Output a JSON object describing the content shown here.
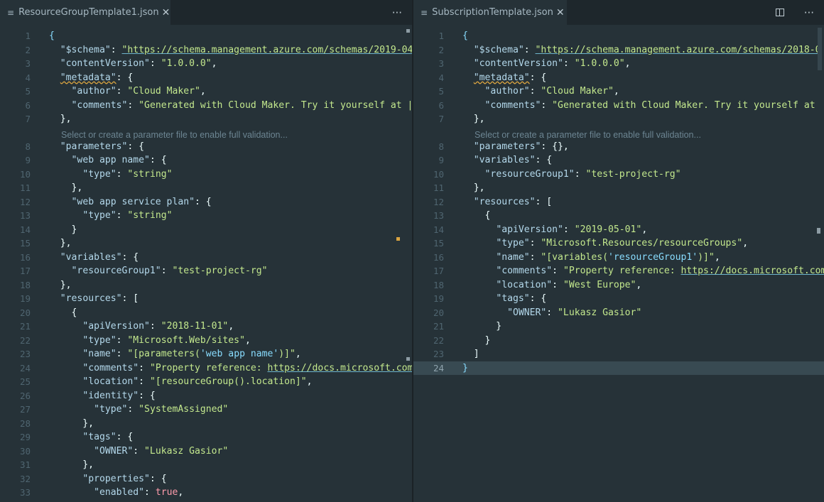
{
  "left": {
    "tab": {
      "icon": "≡",
      "title": "ResourceGroupTemplate1.json",
      "close": "✕"
    },
    "more": "···",
    "hint": "Select or create a parameter file to enable full validation...",
    "lines": [
      {
        "n": "1",
        "html": "<span class=\"p\">{</span>"
      },
      {
        "n": "2",
        "html": "  <span class=\"key\">\"$schema\"</span>: <span class=\"str url\">\"https://schema.management.azure.com/schemas/2019-04</span>"
      },
      {
        "n": "3",
        "html": "  <span class=\"key\">\"contentVersion\"</span>: <span class=\"str\">\"1.0.0.0\"</span>,"
      },
      {
        "n": "4",
        "html": "  <span class=\"key squig\">\"metadata\"</span>: {"
      },
      {
        "n": "5",
        "html": "    <span class=\"key\">\"author\"</span>: <span class=\"str\">\"Cloud Maker\"</span>,"
      },
      {
        "n": "6",
        "html": "    <span class=\"key\">\"comments\"</span>: <span class=\"str\">\"Generated with Cloud Maker. Try it yourself at |</span>"
      },
      {
        "n": "7",
        "html": "  },"
      },
      {
        "n": "8",
        "html": "  <span class=\"key\">\"parameters\"</span>: {"
      },
      {
        "n": "9",
        "html": "    <span class=\"key\">\"web app name\"</span>: {"
      },
      {
        "n": "10",
        "html": "      <span class=\"key\">\"type\"</span>: <span class=\"str\">\"string\"</span>"
      },
      {
        "n": "11",
        "html": "    },"
      },
      {
        "n": "12",
        "html": "    <span class=\"key\">\"web app service plan\"</span>: {"
      },
      {
        "n": "13",
        "html": "      <span class=\"key\">\"type\"</span>: <span class=\"str\">\"string\"</span>"
      },
      {
        "n": "14",
        "html": "    }"
      },
      {
        "n": "15",
        "html": "  },"
      },
      {
        "n": "16",
        "html": "  <span class=\"key\">\"variables\"</span>: {"
      },
      {
        "n": "17",
        "html": "    <span class=\"key\">\"resourceGroup1\"</span>: <span class=\"str\">\"test-project-rg\"</span>"
      },
      {
        "n": "18",
        "html": "  },"
      },
      {
        "n": "19",
        "html": "  <span class=\"key\">\"resources\"</span>: ["
      },
      {
        "n": "20",
        "html": "    {"
      },
      {
        "n": "21",
        "html": "      <span class=\"key\">\"apiVersion\"</span>: <span class=\"str\">\"2018-11-01\"</span>,"
      },
      {
        "n": "22",
        "html": "      <span class=\"key\">\"type\"</span>: <span class=\"str\">\"Microsoft.Web/sites\"</span>,"
      },
      {
        "n": "23",
        "html": "      <span class=\"key\">\"name\"</span>: <span class=\"str\">\"[parameters(<span class=\"p\">'web app name'</span>)]\"</span>,"
      },
      {
        "n": "24",
        "html": "      <span class=\"key\">\"comments\"</span>: <span class=\"str\">\"Property reference: </span><span class=\"str url\">https://docs.microsoft.com</span>"
      },
      {
        "n": "25",
        "html": "      <span class=\"key\">\"location\"</span>: <span class=\"str\">\"[resourceGroup().location]\"</span>,"
      },
      {
        "n": "26",
        "html": "      <span class=\"key\">\"identity\"</span>: {"
      },
      {
        "n": "27",
        "html": "        <span class=\"key\">\"type\"</span>: <span class=\"str\">\"SystemAssigned\"</span>"
      },
      {
        "n": "28",
        "html": "      },"
      },
      {
        "n": "29",
        "html": "      <span class=\"key\">\"tags\"</span>: {"
      },
      {
        "n": "30",
        "html": "        <span class=\"key\">\"OWNER\"</span>: <span class=\"str\">\"Lukasz Gasior\"</span>"
      },
      {
        "n": "31",
        "html": "      },"
      },
      {
        "n": "32",
        "html": "      <span class=\"key\">\"properties\"</span>: {"
      },
      {
        "n": "33",
        "html": "        <span class=\"key\">\"enabled\"</span>: <span class=\"boolv\">true</span>,"
      }
    ]
  },
  "right": {
    "tab": {
      "icon": "≡",
      "title": "SubscriptionTemplate.json",
      "close": "✕"
    },
    "more": "···",
    "hint": "Select or create a parameter file to enable full validation...",
    "lines": [
      {
        "n": "1",
        "html": "<span class=\"p\">{</span>"
      },
      {
        "n": "2",
        "html": "  <span class=\"key\">\"$schema\"</span>: <span class=\"str url\">\"https://schema.management.azure.com/schemas/2018-0</span>"
      },
      {
        "n": "3",
        "html": "  <span class=\"key\">\"contentVersion\"</span>: <span class=\"str\">\"1.0.0.0\"</span>,"
      },
      {
        "n": "4",
        "html": "  <span class=\"key squig\">\"metadata\"</span>: {"
      },
      {
        "n": "5",
        "html": "    <span class=\"key\">\"author\"</span>: <span class=\"str\">\"Cloud Maker\"</span>,"
      },
      {
        "n": "6",
        "html": "    <span class=\"key\">\"comments\"</span>: <span class=\"str\">\"Generated with Cloud Maker. Try it yourself at </span>"
      },
      {
        "n": "7",
        "html": "  },"
      },
      {
        "n": "8",
        "html": "  <span class=\"key\">\"parameters\"</span>: {},"
      },
      {
        "n": "9",
        "html": "  <span class=\"key\">\"variables\"</span>: {"
      },
      {
        "n": "10",
        "html": "    <span class=\"key\">\"resourceGroup1\"</span>: <span class=\"str\">\"test-project-rg\"</span>"
      },
      {
        "n": "11",
        "html": "  },"
      },
      {
        "n": "12",
        "html": "  <span class=\"key\">\"resources\"</span>: ["
      },
      {
        "n": "13",
        "html": "    {"
      },
      {
        "n": "14",
        "html": "      <span class=\"key\">\"apiVersion\"</span>: <span class=\"str\">\"2019-05-01\"</span>,"
      },
      {
        "n": "15",
        "html": "      <span class=\"key\">\"type\"</span>: <span class=\"str\">\"Microsoft.Resources/resourceGroups\"</span>,"
      },
      {
        "n": "16",
        "html": "      <span class=\"key\">\"name\"</span>: <span class=\"str\">\"[variables(<span class=\"p\">'resourceGroup1'</span>)]\"</span>,"
      },
      {
        "n": "17",
        "html": "      <span class=\"key\">\"comments\"</span>: <span class=\"str\">\"Property reference: </span><span class=\"str url\">https://docs.microsoft.com</span>"
      },
      {
        "n": "18",
        "html": "      <span class=\"key\">\"location\"</span>: <span class=\"str\">\"West Europe\"</span>,"
      },
      {
        "n": "19",
        "html": "      <span class=\"key\">\"tags\"</span>: {"
      },
      {
        "n": "20",
        "html": "        <span class=\"key\">\"OWNER\"</span>: <span class=\"str\">\"Lukasz Gasior\"</span>"
      },
      {
        "n": "21",
        "html": "      }"
      },
      {
        "n": "22",
        "html": "    }"
      },
      {
        "n": "23",
        "html": "  ]"
      },
      {
        "n": "24",
        "html": "<span class=\"p\">}</span>"
      }
    ]
  }
}
